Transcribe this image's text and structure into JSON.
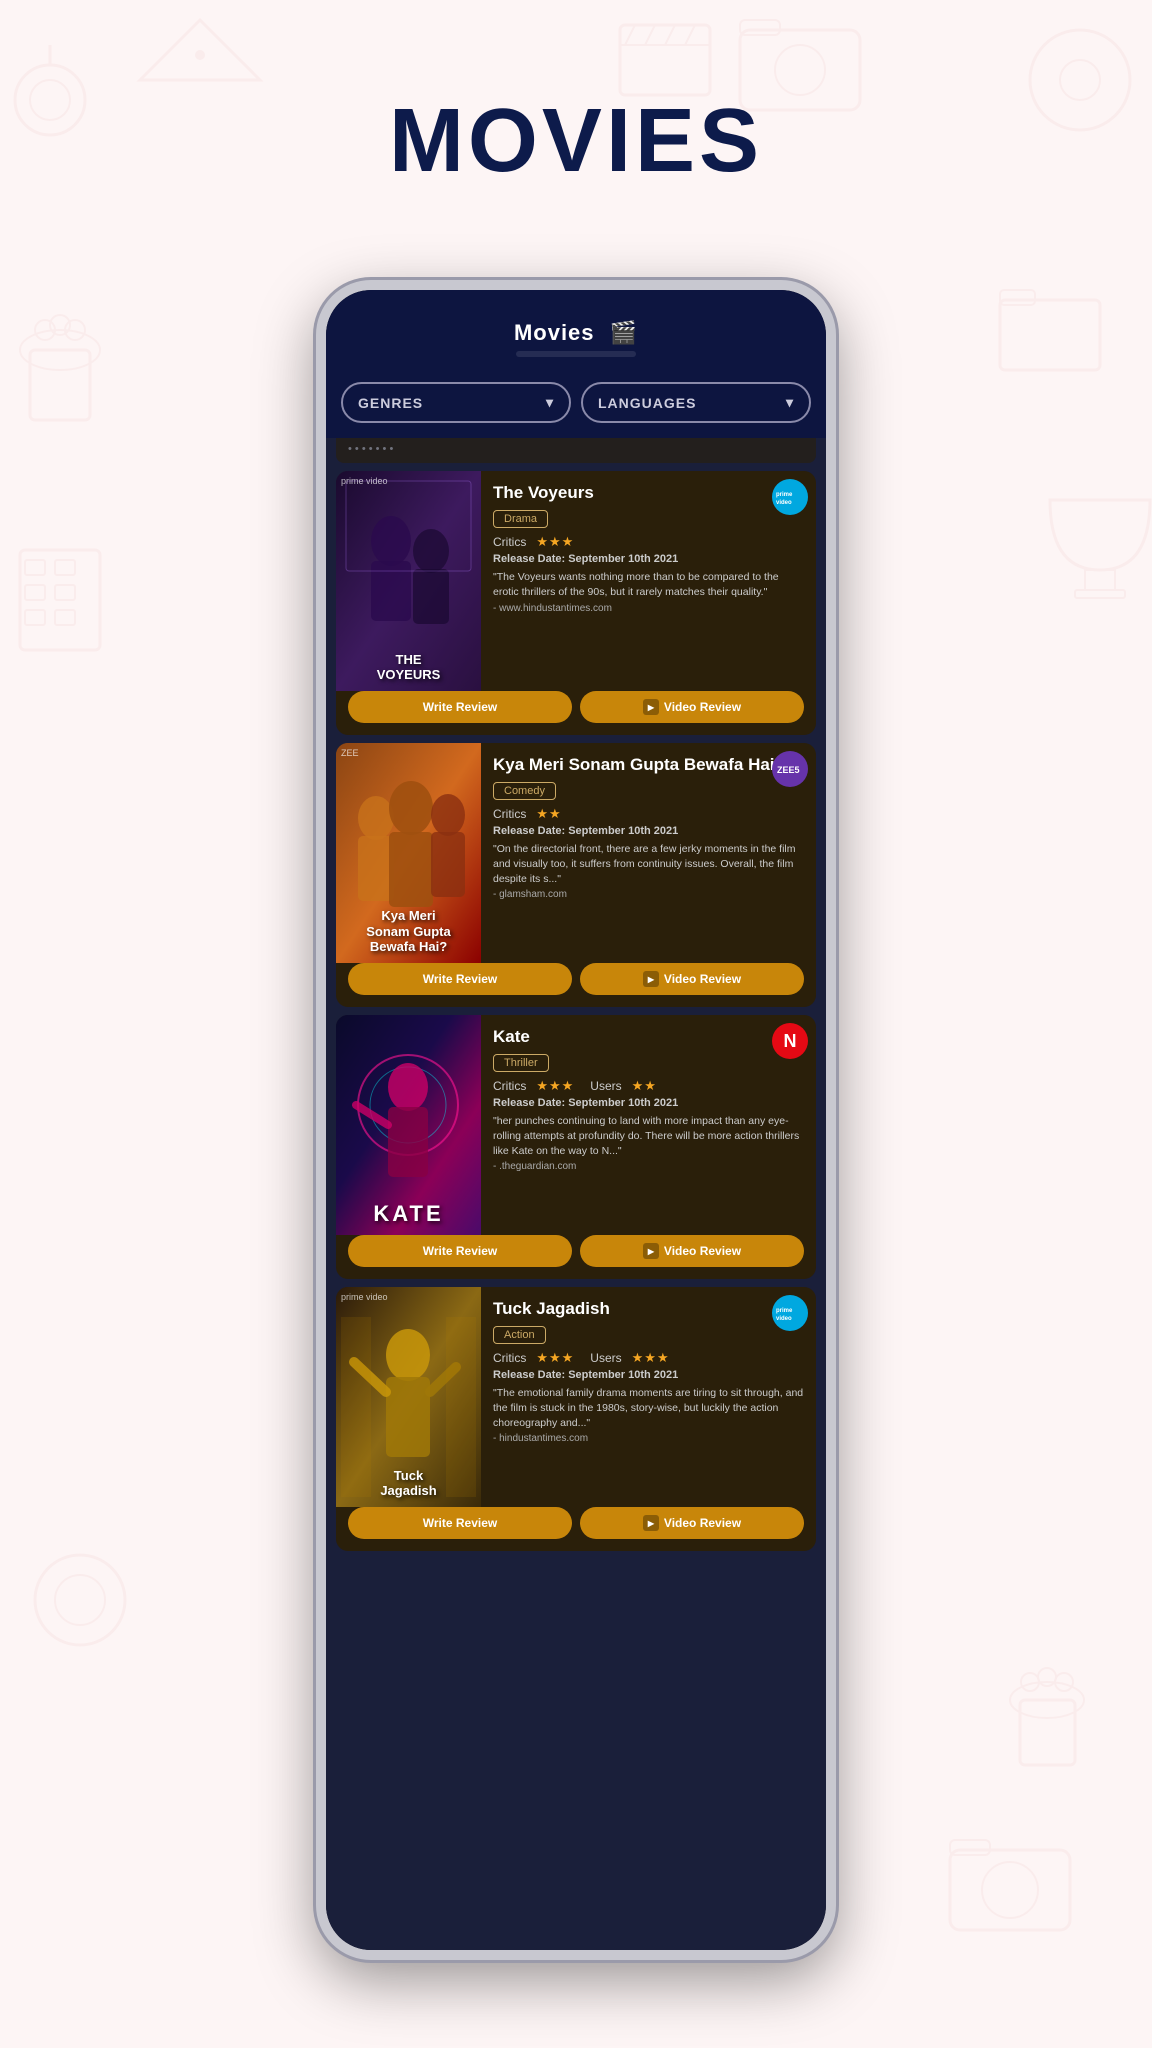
{
  "page": {
    "title": "MOVIES",
    "background_color": "#fdf5f5"
  },
  "phone": {
    "header": {
      "title": "Movies",
      "icon": "🎬"
    },
    "filters": {
      "genres_label": "GENRES",
      "languages_label": "LANGUAGES"
    },
    "movies": [
      {
        "id": "voyeurs",
        "title": "The Voyeurs",
        "genre": "Drama",
        "streaming": "prime",
        "streaming_label": "prime video",
        "critics_stars": 3,
        "users_stars": null,
        "release_date": "September 10th 2021",
        "review": "\"The Voyeurs wants nothing more than to be compared to the erotic thrillers of the 90s, but it rarely matches their quality.\"",
        "source": "- www.hindustantimes.com",
        "poster_text": "THE\nVOYEURS",
        "poster_top_label": "prime video"
      },
      {
        "id": "sonam",
        "title": "Kya Meri Sonam Gupta Bewafa Hai",
        "genre": "Comedy",
        "streaming": "zee5",
        "streaming_label": "ZEE5",
        "critics_stars": 2,
        "users_stars": null,
        "release_date": "September 10th 2021",
        "review": "\"On the directorial front, there are a few jerky moments in the film and visually too, it suffers from continuity issues.  Overall, the film despite its s...\"",
        "source": "- glamsham.com",
        "poster_text": "Kya Meri\nSonam Gupta\nBewafa Hai?",
        "poster_top_label": "ZEE"
      },
      {
        "id": "kate",
        "title": "Kate",
        "genre": "Thriller",
        "streaming": "netflix",
        "streaming_label": "N",
        "critics_stars": 3,
        "critics_half": false,
        "users_stars": 2,
        "release_date": "September 10th 2021",
        "review": "\"her punches continuing to land with more impact than any eye-rolling attempts at profundity do. There will be more action thrillers like Kate on the way to N...\"",
        "source": "- .theguardian.com",
        "poster_text": "KATE",
        "poster_top_label": ""
      },
      {
        "id": "tuck",
        "title": "Tuck Jagadish",
        "genre": "Action",
        "streaming": "prime2",
        "streaming_label": "prime video",
        "critics_stars": 3,
        "users_stars": 3,
        "release_date": "September 10th 2021",
        "review": "\"The emotional family drama moments are tiring to sit through, and the film is stuck in the 1980s, story-wise, but luckily the action choreography and...\"",
        "source": "- hindustantimes.com",
        "poster_text": "Tuck\nJagadish",
        "poster_top_label": "prime video"
      }
    ],
    "buttons": {
      "write_review": "Write Review",
      "video_review": "Video Review"
    }
  }
}
